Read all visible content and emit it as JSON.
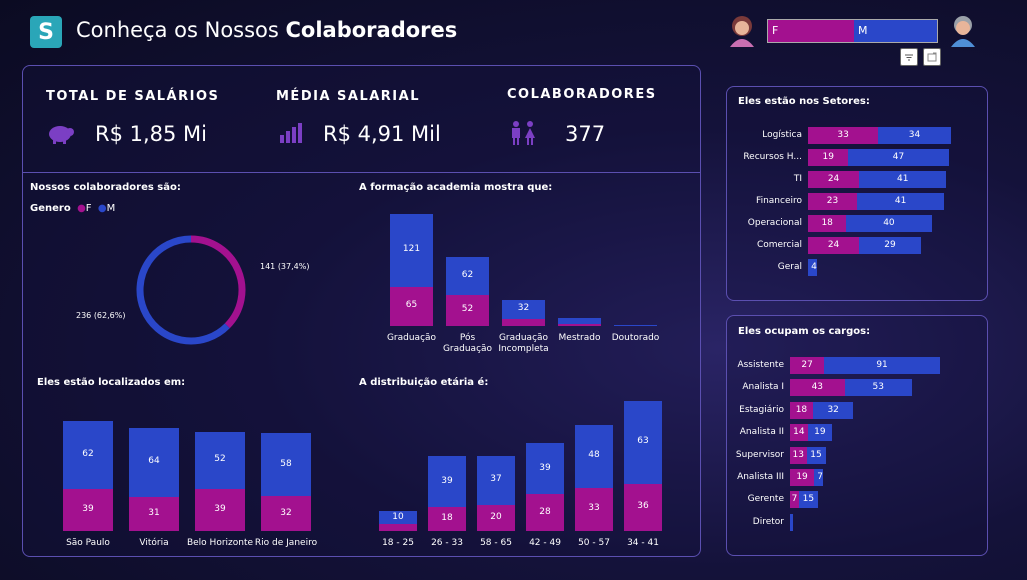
{
  "header": {
    "title_prefix": "Conheça os Nossos ",
    "title_bold": "Colaboradores",
    "logo_letter": "S",
    "gender_filter": {
      "f_label": "F",
      "m_label": "M"
    }
  },
  "colors": {
    "female": "#a3118f",
    "male": "#2a47c9",
    "accent_icon": "#7b3fc4"
  },
  "kpis": [
    {
      "label": "TOTAL DE SALÁRIOS",
      "value": "R$ 1,85 Mi",
      "icon": "piggy-bank-icon"
    },
    {
      "label": "MÉDIA SALARIAL",
      "value": "R$ 4,91 Mil",
      "icon": "bar-chart-icon"
    },
    {
      "label": "COLABORADORES",
      "value": "377",
      "icon": "people-icon"
    }
  ],
  "chart_data": [
    {
      "type": "pie",
      "title": "Nossos colaboradores são:",
      "legend_title": "Genero",
      "categories": [
        "F",
        "M"
      ],
      "values": [
        141,
        236
      ],
      "labels": [
        "141 (37,4%)",
        "236 (62,6%)"
      ]
    },
    {
      "type": "bar",
      "title": "A formação academia mostra que:",
      "categories": [
        "Graduação",
        "Pós Graduação",
        "Graduação Incompleta",
        "Mestrado",
        "Doutorado"
      ],
      "series": [
        {
          "name": "F",
          "values": [
            65,
            52,
            12,
            3,
            1
          ]
        },
        {
          "name": "M",
          "values": [
            121,
            62,
            32,
            10,
            1
          ]
        }
      ],
      "shown_labels": {
        "F": [
          "65",
          "52",
          "",
          "",
          ""
        ],
        "M": [
          "121",
          "62",
          "32",
          "",
          ""
        ]
      }
    },
    {
      "type": "bar",
      "title": "Eles estão localizados em:",
      "categories": [
        "São Paulo",
        "Vitória",
        "Belo Horizonte",
        "Rio de Janeiro"
      ],
      "series": [
        {
          "name": "F",
          "values": [
            39,
            31,
            39,
            32
          ]
        },
        {
          "name": "M",
          "values": [
            62,
            64,
            52,
            58
          ]
        }
      ]
    },
    {
      "type": "bar",
      "title": "A distribuição etária é:",
      "categories": [
        "18 - 25",
        "26 - 33",
        "58 - 65",
        "42 - 49",
        "50 - 57",
        "34 - 41"
      ],
      "series": [
        {
          "name": "F",
          "values": [
            5,
            18,
            20,
            28,
            33,
            36
          ]
        },
        {
          "name": "M",
          "values": [
            10,
            39,
            37,
            39,
            48,
            63
          ]
        }
      ],
      "shown_labels": {
        "F": [
          "",
          "18",
          "20",
          "28",
          "33",
          "36"
        ],
        "M": [
          "10",
          "39",
          "37",
          "39",
          "48",
          "63"
        ]
      }
    },
    {
      "type": "bar",
      "title": "Eles estão nos Setores:",
      "orientation": "horizontal",
      "categories": [
        "Logística",
        "Recursos H...",
        "TI",
        "Financeiro",
        "Operacional",
        "Comercial",
        "Geral"
      ],
      "series": [
        {
          "name": "F",
          "values": [
            33,
            19,
            24,
            23,
            18,
            24,
            0
          ]
        },
        {
          "name": "M",
          "values": [
            34,
            47,
            41,
            41,
            40,
            29,
            4
          ]
        }
      ]
    },
    {
      "type": "bar",
      "title": "Eles ocupam os cargos:",
      "orientation": "horizontal",
      "categories": [
        "Assistente",
        "Analista I",
        "Estagiário",
        "Analista II",
        "Supervisor",
        "Analista III",
        "Gerente",
        "Diretor"
      ],
      "series": [
        {
          "name": "F",
          "values": [
            27,
            43,
            18,
            14,
            13,
            19,
            7,
            0
          ]
        },
        {
          "name": "M",
          "values": [
            91,
            53,
            32,
            19,
            15,
            7,
            15,
            2
          ]
        }
      ],
      "shown_labels": {
        "F": [
          "27",
          "43",
          "18",
          "14",
          "13",
          "19",
          "7",
          ""
        ],
        "M": [
          "91",
          "53",
          "32",
          "19",
          "15",
          "7",
          "15",
          ""
        ]
      }
    }
  ]
}
